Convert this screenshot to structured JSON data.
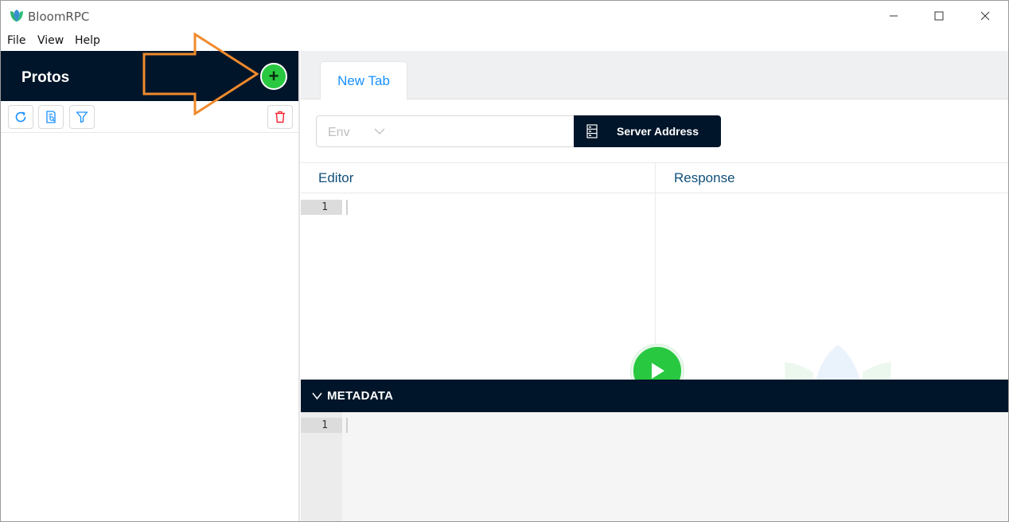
{
  "window": {
    "title": "BloomRPC"
  },
  "menu": {
    "items": [
      "File",
      "View",
      "Help"
    ]
  },
  "sidebar": {
    "title": "Protos",
    "add_button_symbol": "+"
  },
  "tabs": [
    {
      "label": "New Tab"
    }
  ],
  "address_bar": {
    "env_placeholder": "Env",
    "address_value": "",
    "server_button_label": "Server Address"
  },
  "editor": {
    "title": "Editor",
    "line_number": "1"
  },
  "response": {
    "title": "Response"
  },
  "metadata": {
    "label": "METADATA",
    "line_number": "1"
  },
  "colors": {
    "sidebar_header": "#001529",
    "accent_blue": "#1890ff",
    "run_green": "#28c840",
    "annotation_orange": "#f08a2c",
    "danger_red": "#f5222d"
  }
}
